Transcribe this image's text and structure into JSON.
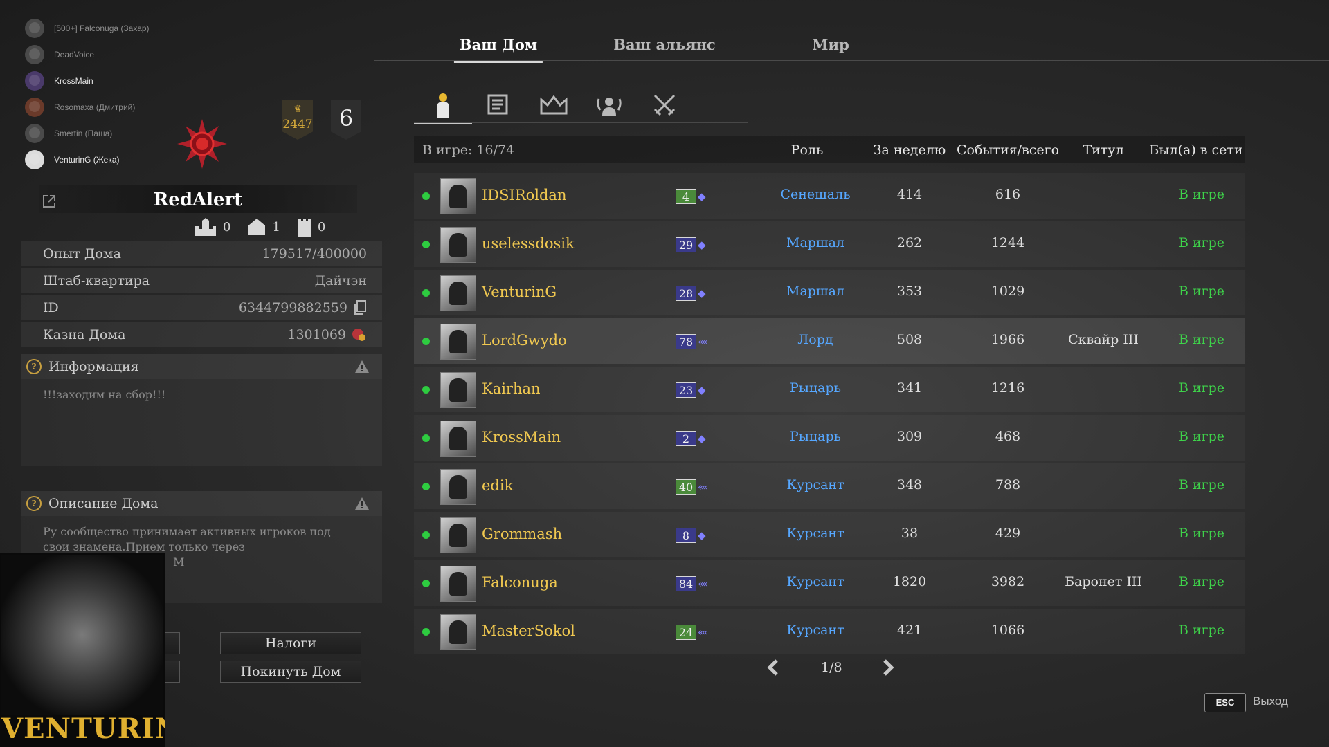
{
  "voice_channel": {
    "users": [
      {
        "name": "[500+] Falconuga (Захар)",
        "active": false
      },
      {
        "name": "DeadVoice",
        "active": false
      },
      {
        "name": "KrossMain",
        "active": true
      },
      {
        "name": "Rosomaxa (Дмитрий)",
        "active": false
      },
      {
        "name": "Smertin (Паша)",
        "active": false
      },
      {
        "name": "VenturinG (Жека)",
        "active": true
      }
    ]
  },
  "tabs": {
    "house": "Ваш Дом",
    "alliance": "Ваш альянс",
    "world": "Мир"
  },
  "house": {
    "level": "2447",
    "rank": "6",
    "name": "RedAlert",
    "count_1": "0",
    "count_2": "1",
    "count_3": "0",
    "rows": {
      "exp_label": "Опыт Дома",
      "exp_value": "179517/400000",
      "hq_label": "Штаб-квартира",
      "hq_value": "Дайчэн",
      "id_label": "ID",
      "id_value": "6344799882559",
      "treasury_label": "Казна Дома",
      "treasury_value": "1301069"
    },
    "info_title": "Информация",
    "info_text": "!!!заходим на сбор!!!",
    "desc_title": "Описание Дома",
    "desc_line1": "Ру сообщество принимает активных игроков под",
    "desc_line2": "свои знамена.Прием только через",
    "desc_line3": "М"
  },
  "buttons": {
    "taxes": "Налоги",
    "leave": "Покинуть Дом"
  },
  "webcam": {
    "name": "VENTURING"
  },
  "subtabs": [
    "members",
    "log",
    "ranks",
    "management",
    "war"
  ],
  "table": {
    "online_count": "В игре: 16/74",
    "headers": {
      "role": "Роль",
      "week": "За неделю",
      "events": "События/всего",
      "title": "Титул",
      "last_seen": "Был(а) в сети"
    },
    "rows": [
      {
        "name": "IDSIRoldan",
        "level": "4",
        "role": "Сенешаль",
        "week": "414",
        "total": "616",
        "title": "",
        "status": "В игре",
        "level_color": "green"
      },
      {
        "name": "uselessdosik",
        "level": "29",
        "role": "Маршал",
        "week": "262",
        "total": "1244",
        "title": "",
        "status": "В игре",
        "level_color": "blue"
      },
      {
        "name": "VenturinG",
        "level": "28",
        "role": "Маршал",
        "week": "353",
        "total": "1029",
        "title": "",
        "status": "В игре",
        "level_color": "blue"
      },
      {
        "name": "LordGwydo",
        "level": "78",
        "role": "Лорд",
        "week": "508",
        "total": "1966",
        "title": "Сквайр III",
        "status": "В игре",
        "level_color": "blue"
      },
      {
        "name": "Kairhan",
        "level": "23",
        "role": "Рыцарь",
        "week": "341",
        "total": "1216",
        "title": "",
        "status": "В игре",
        "level_color": "blue"
      },
      {
        "name": "KrossMain",
        "level": "2",
        "role": "Рыцарь",
        "week": "309",
        "total": "468",
        "title": "",
        "status": "В игре",
        "level_color": "blue"
      },
      {
        "name": "edik",
        "level": "40",
        "role": "Курсант",
        "week": "348",
        "total": "788",
        "title": "",
        "status": "В игре",
        "level_color": "green"
      },
      {
        "name": "Grommash",
        "level": "8",
        "role": "Курсант",
        "week": "38",
        "total": "429",
        "title": "",
        "status": "В игре",
        "level_color": "blue"
      },
      {
        "name": "Falconuga",
        "level": "84",
        "role": "Курсант",
        "week": "1820",
        "total": "3982",
        "title": "Баронет III",
        "status": "В игре",
        "level_color": "blue"
      },
      {
        "name": "MasterSokol",
        "level": "24",
        "role": "Курсант",
        "week": "421",
        "total": "1066",
        "title": "",
        "status": "В игре",
        "level_color": "green"
      }
    ]
  },
  "pagination": {
    "text": "1/8"
  },
  "footer": {
    "esc": "ESC",
    "exit": "Выход"
  }
}
